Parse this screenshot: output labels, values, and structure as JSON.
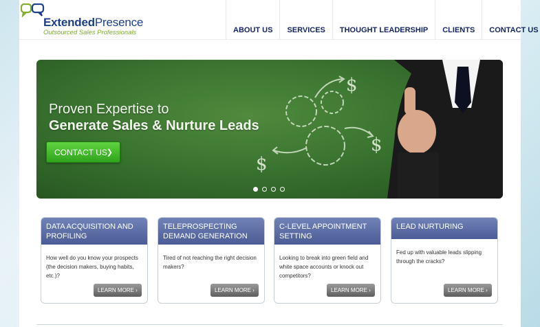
{
  "brand": {
    "name_bold": "Extended",
    "name_light": "Presence",
    "tagline": "Outsourced Sales Professionals"
  },
  "nav": [
    {
      "label": "ABOUT US"
    },
    {
      "label": "SERVICES"
    },
    {
      "label": "THOUGHT LEADERSHIP"
    },
    {
      "label": "CLIENTS"
    },
    {
      "label": "CONTACT US"
    }
  ],
  "hero": {
    "line1": "Proven Expertise to",
    "line2": "Generate Sales & Nurture Leads",
    "cta_label": "CONTACT US",
    "slides_total": 4,
    "active_slide": 1
  },
  "cards": [
    {
      "title": "DATA ACQUISITION AND PROFILING",
      "body": "How well do you know your prospects (the decision makers, buying habits, etc.)?",
      "button": "LEARN MORE"
    },
    {
      "title": "TELEPROSPECTING DEMAND GENERATION",
      "body": "Tired of not reaching the right decision makers?",
      "button": "LEARN MORE"
    },
    {
      "title": "C-LEVEL APPOINTMENT SETTING",
      "body": "Looking to break into green field and white space accounts or knock out competitors?",
      "button": "LEARN MORE"
    },
    {
      "title": "LEAD NURTURING",
      "body": "Fed up with valuable leads slipping through the cracks?",
      "button": "LEARN MORE"
    }
  ],
  "colors": {
    "brand_blue": "#1d3f87",
    "nav_text": "#13255e",
    "accent_green": "#7fae2c",
    "card_header": "#5a6aa3",
    "cta_green": "#3bb326"
  }
}
